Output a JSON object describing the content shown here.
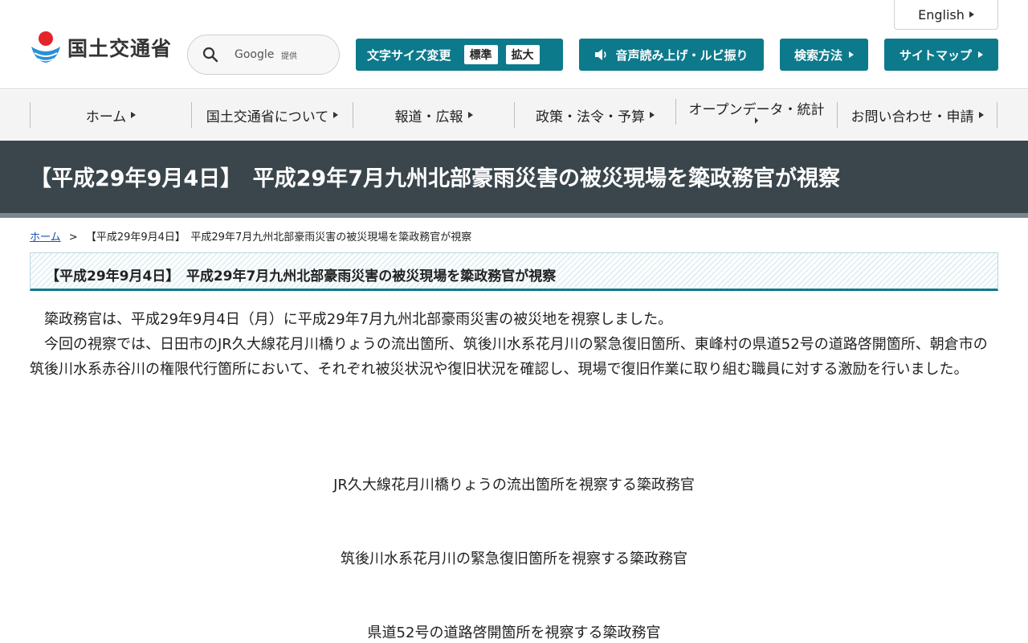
{
  "header": {
    "logo_text": "国土交通省",
    "search": {
      "placeholder": "Google",
      "provider": "提供"
    },
    "english_label": "English",
    "font_size": {
      "label": "文字サイズ変更",
      "standard": "標準",
      "large": "拡大"
    },
    "voice_label": "音声読み上げ・ルビ振り",
    "search_method_label": "検索方法",
    "sitemap_label": "サイトマップ"
  },
  "nav": {
    "items": [
      {
        "label": "ホーム"
      },
      {
        "label": "国土交通省について"
      },
      {
        "label": "報道・広報"
      },
      {
        "label": "政策・法令・予算"
      },
      {
        "label": "オープンデータ・統計"
      },
      {
        "label": "お問い合わせ・申請"
      }
    ]
  },
  "page": {
    "title": "【平成29年9月4日】　平成29年7月九州北部豪雨災害の被災現場を簗政務官が視察",
    "breadcrumb": {
      "home": "ホーム",
      "separator": ">",
      "current": "【平成29年9月4日】　平成29年7月九州北部豪雨災害の被災現場を簗政務官が視察"
    },
    "section_title": "【平成29年9月4日】　平成29年7月九州北部豪雨災害の被災現場を簗政務官が視察",
    "paragraphs": [
      "簗政務官は、平成29年9月4日（月）に平成29年7月九州北部豪雨災害の被災地を視察しました。",
      "今回の視察では、日田市のJR久大線花月川橋りょうの流出箇所、筑後川水系花月川の緊急復旧箇所、東峰村の県道52号の道路啓開箇所、朝倉市の筑後川水系赤谷川の権限代行箇所において、それぞれ被災状況や復旧状況を確認し、現場で復旧作業に取り組む職員に対する激励を行いました。"
    ],
    "captions": [
      "JR久大線花月川橋りょうの流出箇所を視察する簗政務官",
      "筑後川水系花月川の緊急復旧箇所を視察する簗政務官",
      "県道52号の道路啓開箇所を視察する簗政務官"
    ]
  },
  "colors": {
    "accent": "#0d7a8c",
    "title_band": "#3a464c",
    "nav_bg": "#f4f4f4"
  }
}
